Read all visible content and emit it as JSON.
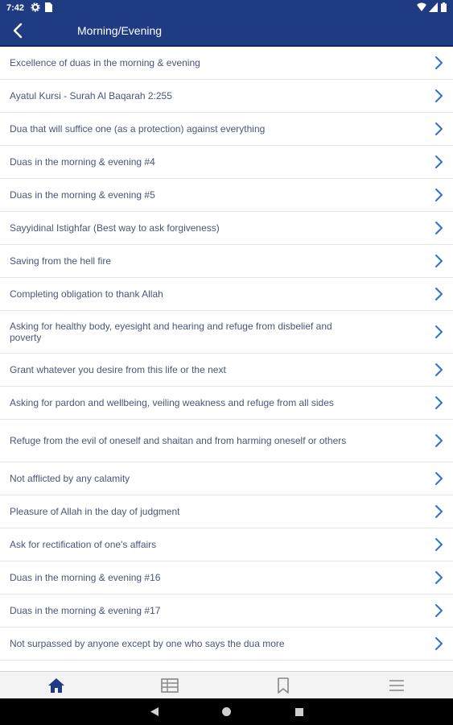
{
  "status_bar": {
    "time": "7:42",
    "icons": [
      "gear-icon",
      "sim-icon",
      "wifi-icon",
      "signal-icon",
      "battery-icon"
    ]
  },
  "app_bar": {
    "title": "Morning/Evening",
    "back_icon": "chevron-left-icon"
  },
  "colors": {
    "primary": "#1f3b82",
    "chevron": "#2f6fd6",
    "text": "#4a5678",
    "nav_active": "#1f3b82",
    "nav_inactive": "#888888"
  },
  "list": {
    "items": [
      {
        "label": "Excellence of duas in the morning & evening"
      },
      {
        "label": "Ayatul Kursi - Surah Al Baqarah 2:255"
      },
      {
        "label": "Dua that will suffice one (as a protection) against everything"
      },
      {
        "label": "Duas in the morning & evening #4"
      },
      {
        "label": "Duas in the morning & evening #5"
      },
      {
        "label": "Sayyidinal Istighfar (Best way to ask forgiveness)"
      },
      {
        "label": "Saving from the hell fire"
      },
      {
        "label": "Completing obligation to thank Allah"
      },
      {
        "label": "Asking for healthy body, eyesight and hearing and refuge from disbelief and poverty"
      },
      {
        "label": "Grant whatever you desire from this life or the next"
      },
      {
        "label": "Asking for pardon and wellbeing, veiling weakness and refuge from all sides"
      },
      {
        "label": "Refuge from the evil of oneself and shaitan and from harming oneself or others"
      },
      {
        "label": "Not afflicted by any calamity"
      },
      {
        "label": "Pleasure of Allah in the day of judgment"
      },
      {
        "label": "Ask for rectification of one's affairs"
      },
      {
        "label": "Duas in the morning & evening #16"
      },
      {
        "label": "Duas in the morning & evening #17"
      },
      {
        "label": "Not surpassed by anyone except by one who says the dua more"
      }
    ]
  },
  "bottom_nav": {
    "items": [
      "home-icon",
      "table-icon",
      "bookmark-icon",
      "menu-icon"
    ],
    "active": "home-icon"
  },
  "system_nav": [
    "back-triangle-icon",
    "home-circle-icon",
    "recents-square-icon"
  ]
}
